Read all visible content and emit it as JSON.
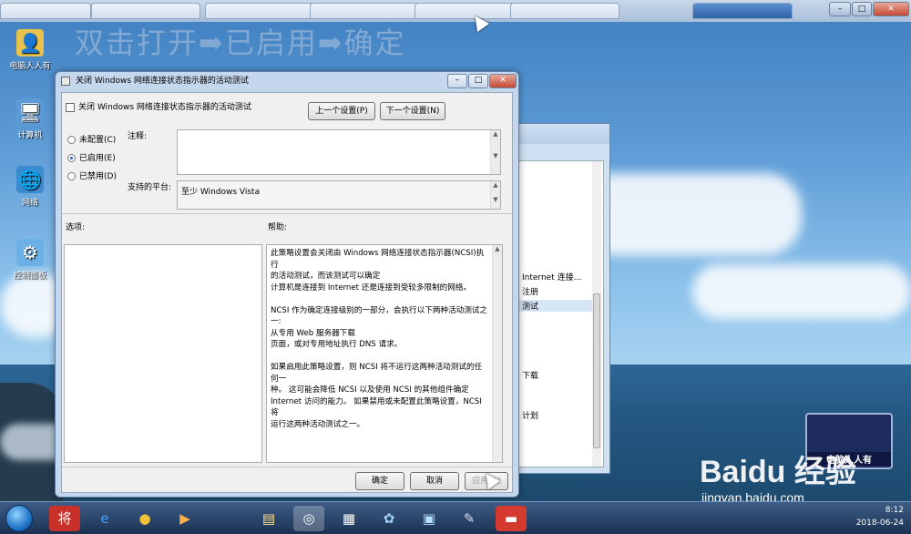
{
  "desktop": {
    "overlay_text": "双击打开➡已启用➡确定",
    "icons": [
      {
        "label": "电脑人人有"
      },
      {
        "label": "计算机"
      },
      {
        "label": "网络"
      },
      {
        "label": "控制面板"
      }
    ]
  },
  "dialog": {
    "window_title": "关闭 Windows 网络连接状态指示器的活动测试",
    "policy_name": "关闭 Windows 网络连接状态指示器的活动测试",
    "prev_button": "上一个设置(P)",
    "next_button": "下一个设置(N)",
    "radio": {
      "not_configured": "未配置(C)",
      "enabled": "已启用(E)",
      "disabled": "已禁用(D)",
      "selected": "enabled"
    },
    "comment_label": "注释:",
    "platform_label": "支持的平台:",
    "platform_value": "至少 Windows Vista",
    "options_label": "选项:",
    "help_label": "帮助:",
    "help_text": "此策略设置会关闭由 Windows 网络连接状态指示器(NCSI)执行\n的活动测试，而该测试可以确定\n计算机是连接到 Internet 还是连接到受较多限制的网络。\n\nNCSI 作为确定连接级别的一部分，会执行以下两种活动测试之一: \n从专用 Web 服务器下载\n页面，或对专用地址执行 DNS 请求。\n\n如果启用此策略设置，则 NCSI 将不运行这两种活动测试的任何一\n种。 这可能会降低 NCSI 以及使用 NCSI 的其他组件确定\nInternet 访问的能力。 如果禁用或未配置此策略设置，NCSI 将\n运行这两种活动测试之一。",
    "ok_button": "确定",
    "cancel_button": "取消",
    "apply_button": "应用(A)"
  },
  "background_window": {
    "rows": [
      "Internet 连接...",
      "注册",
      "测试",
      "下载",
      "计划"
    ]
  },
  "watermark": {
    "logo_text": "电脑人人有",
    "baidu": "Baidu 经验",
    "url": "jingyan.baidu.com"
  },
  "taskbar": {
    "time": "8:12",
    "date": "2018-06-24"
  }
}
